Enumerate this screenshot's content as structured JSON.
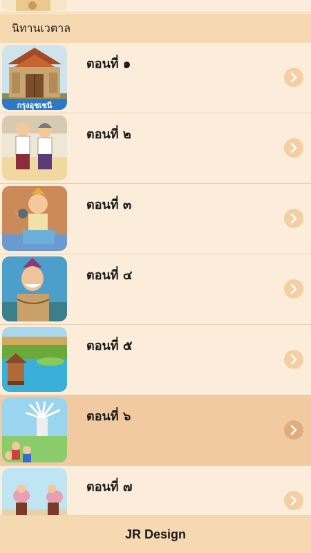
{
  "section": {
    "title": "นิทานเวตาล"
  },
  "episodes": [
    {
      "title": "ตอนที่ ๑",
      "thumb_icon": "palace-gate-thumbnail",
      "thumb_caption": "กรุงอุชเชนี"
    },
    {
      "title": "ตอนที่ ๒",
      "thumb_icon": "two-villagers-thumbnail"
    },
    {
      "title": "ตอนที่ ๓",
      "thumb_icon": "princess-with-bird-thumbnail"
    },
    {
      "title": "ตอนที่ ๔",
      "thumb_icon": "old-man-thumbnail"
    },
    {
      "title": "ตอนที่ ๕",
      "thumb_icon": "river-village-thumbnail"
    },
    {
      "title": "ตอนที่ ๖",
      "thumb_icon": "many-armed-deity-thumbnail",
      "selected": true
    },
    {
      "title": "ตอนที่ ๗",
      "thumb_icon": "procession-thumbnail"
    }
  ],
  "footer": {
    "label": "JR Design"
  },
  "colors": {
    "background": "#fcecda",
    "header": "#f7d9b1",
    "selected_row": "#f2caa2",
    "chevron": "#f4cfa3"
  }
}
